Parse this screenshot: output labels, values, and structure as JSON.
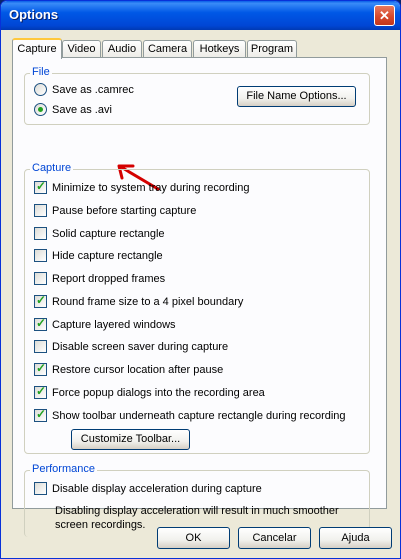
{
  "window": {
    "title": "Options"
  },
  "tabs": [
    "Capture",
    "Video",
    "Audio",
    "Camera",
    "Hotkeys",
    "Program"
  ],
  "file": {
    "legend": "File",
    "radios": [
      {
        "label": "Save as .camrec",
        "selected": false
      },
      {
        "label": "Save as .avi",
        "selected": true
      }
    ],
    "name_options_button": "File Name Options..."
  },
  "capture": {
    "legend": "Capture",
    "options": [
      {
        "label": "Minimize to system tray during recording",
        "checked": true
      },
      {
        "label": "Pause before starting capture",
        "checked": false
      },
      {
        "label": "Solid capture rectangle",
        "checked": false
      },
      {
        "label": "Hide capture rectangle",
        "checked": false
      },
      {
        "label": "Report dropped frames",
        "checked": false
      },
      {
        "label": "Round frame size to a 4 pixel boundary",
        "checked": true
      },
      {
        "label": "Capture layered windows",
        "checked": true
      },
      {
        "label": "Disable screen saver during capture",
        "checked": false
      },
      {
        "label": "Restore cursor location after pause",
        "checked": true
      },
      {
        "label": "Force popup dialogs into the recording area",
        "checked": true
      },
      {
        "label": "Show toolbar underneath capture rectangle during recording",
        "checked": true
      }
    ],
    "customize_button": "Customize Toolbar..."
  },
  "performance": {
    "legend": "Performance",
    "option": {
      "label": "Disable display acceleration during capture",
      "checked": false
    },
    "note": "Disabling display acceleration will result in much smoother screen recordings."
  },
  "footer": {
    "ok": "OK",
    "cancel": "Cancelar",
    "help": "Ajuda"
  },
  "colors": {
    "title_bar": "#0058e6",
    "group_legend": "#0046d5",
    "check_mark": "#21a121",
    "annotation_arrow": "#d40000"
  }
}
